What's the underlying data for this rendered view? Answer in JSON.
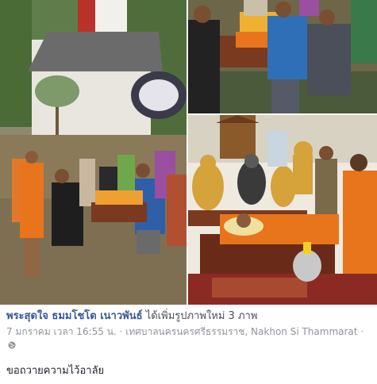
{
  "post": {
    "author": "พระสุดใจ ธมมโชโต เนาวพันธ์",
    "action": "ได้เพิ่มรูปภาพใหม่ 3 ภาพ",
    "date": "7 มกราคม เวลา 16:55 น.",
    "separator": "·",
    "location": "เทศบาลนครนครศรีธรรมราช, Nakhon Si Thammarat",
    "audience_icon": "globe-icon",
    "caption": "ขอถวายความไว้อาลัย"
  },
  "photos": [
    {
      "name": "flood-procession-photo"
    },
    {
      "name": "carrying-monk-photo"
    },
    {
      "name": "shrine-monk-photo"
    }
  ],
  "colors": {
    "author_link": "#365899",
    "meta_text": "#90949c",
    "robe": "#e8741c",
    "flood_water": "#8a7a5a"
  }
}
